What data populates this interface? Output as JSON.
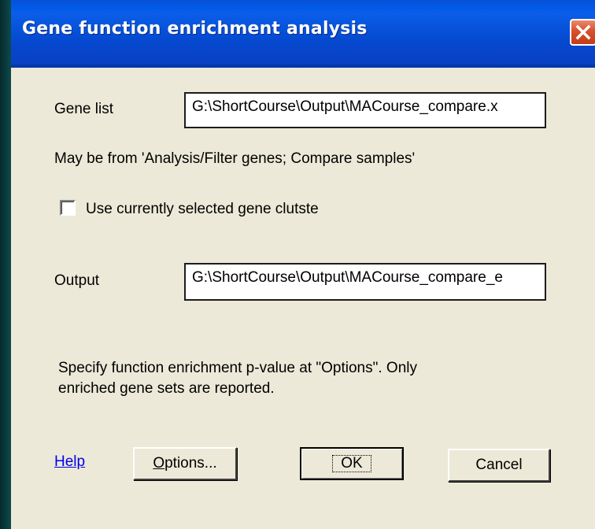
{
  "window": {
    "title": "Gene function enrichment analysis"
  },
  "form": {
    "gene_list_label": "Gene list",
    "gene_list_value": "G:\\ShortCourse\\Output\\MACourse_compare.x",
    "hint": "May be from 'Analysis/Filter genes; Compare samples'",
    "checkbox_label": "Use currently selected gene clutste",
    "checkbox_checked": false,
    "output_label": "Output",
    "output_value": "G:\\ShortCourse\\Output\\MACourse_compare_e",
    "note_line1": "Specify function enrichment p-value at \"Options\". Only",
    "note_line2": "enriched gene sets are reported."
  },
  "buttons": {
    "help": "Help",
    "options_mnemonic": "O",
    "options_rest": "ptions...",
    "ok": "OK",
    "cancel": "Cancel"
  },
  "icons": {
    "close": "close-icon"
  },
  "colors": {
    "titlebar": "#0a5ee8",
    "dialog_bg": "#ece9d8",
    "close": "#d8502c",
    "link": "#0000ee"
  }
}
